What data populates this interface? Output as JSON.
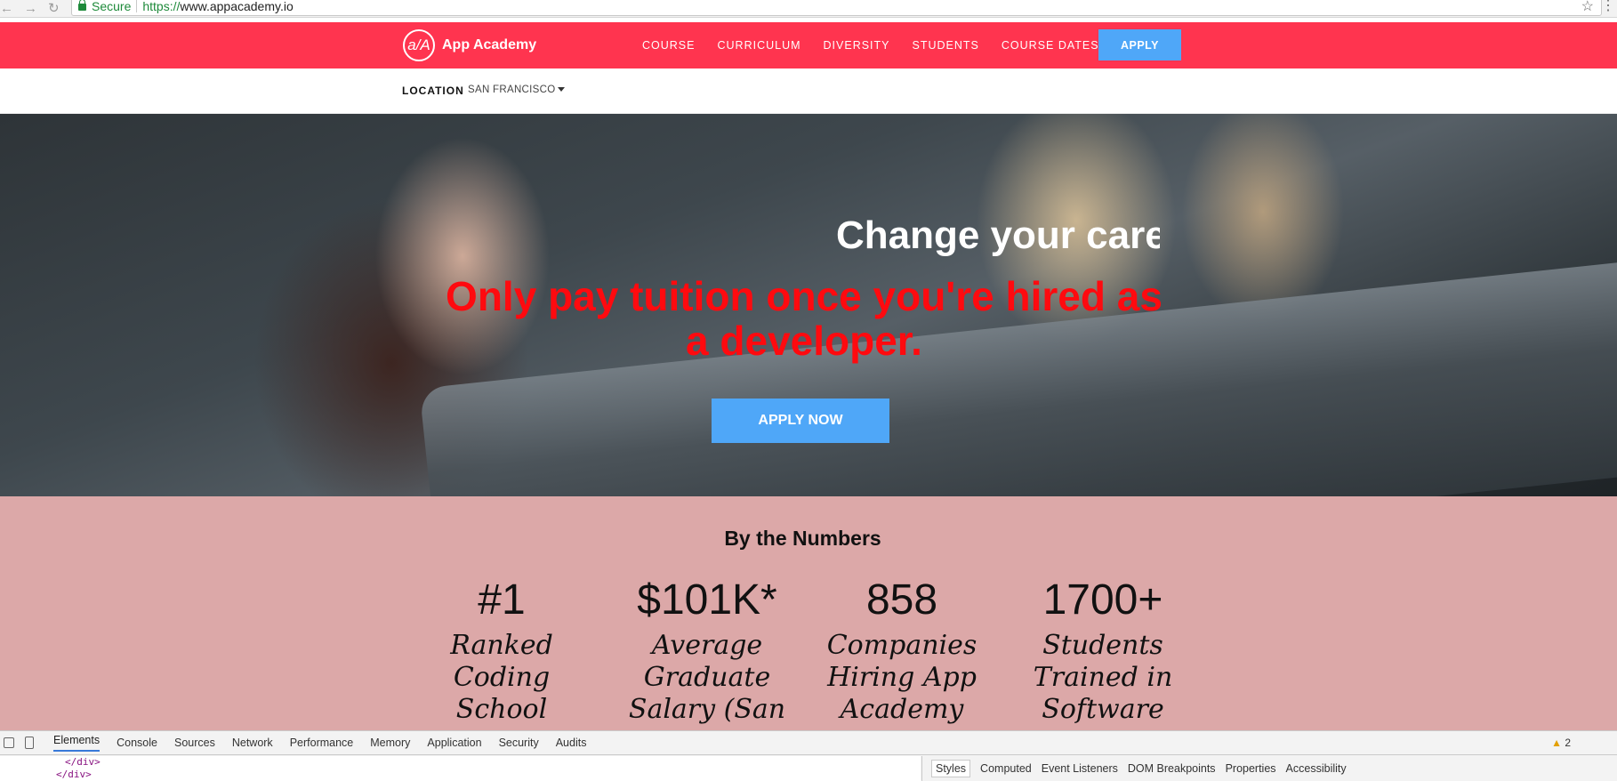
{
  "browser": {
    "secure_label": "Secure",
    "url_protocol": "https://",
    "url_host": "www.appacademy.io"
  },
  "header": {
    "logo_mark": "a/A",
    "logo_text": "App Academy",
    "menu": [
      "COURSE",
      "CURRICULUM",
      "DIVERSITY",
      "STUDENTS",
      "COURSE DATES"
    ],
    "apply_label": "APPLY",
    "accent_color": "#ff344f",
    "button_color": "#4fa7f8"
  },
  "location": {
    "label": "LOCATION",
    "value": "SAN FRANCISCO"
  },
  "hero": {
    "title": "Change your care",
    "subtitle": "Only pay tuition once you're hired as a developer.",
    "cta_label": "APPLY NOW",
    "subtitle_color": "#ff0a0f"
  },
  "numbers": {
    "title": "By the Numbers",
    "stats": [
      {
        "value": "#1",
        "label_lines": [
          "Ranked",
          "Coding",
          "School"
        ]
      },
      {
        "value": "$101K*",
        "label_lines": [
          "Average",
          "Graduate",
          "Salary (San"
        ]
      },
      {
        "value": "858",
        "label_lines": [
          "Companies",
          "Hiring App",
          "Academy"
        ]
      },
      {
        "value": "1700+",
        "label_lines": [
          "Students",
          "Trained in",
          "Software"
        ]
      }
    ]
  },
  "devtools": {
    "tabs": [
      "Elements",
      "Console",
      "Sources",
      "Network",
      "Performance",
      "Memory",
      "Application",
      "Security",
      "Audits"
    ],
    "active_tab": "Elements",
    "warning_count": "2",
    "code_lines": [
      "</div>",
      "</div>"
    ],
    "side_tabs": [
      "Styles",
      "Computed",
      "Event Listeners",
      "DOM Breakpoints",
      "Properties",
      "Accessibility"
    ],
    "active_side_tab": "Styles"
  }
}
